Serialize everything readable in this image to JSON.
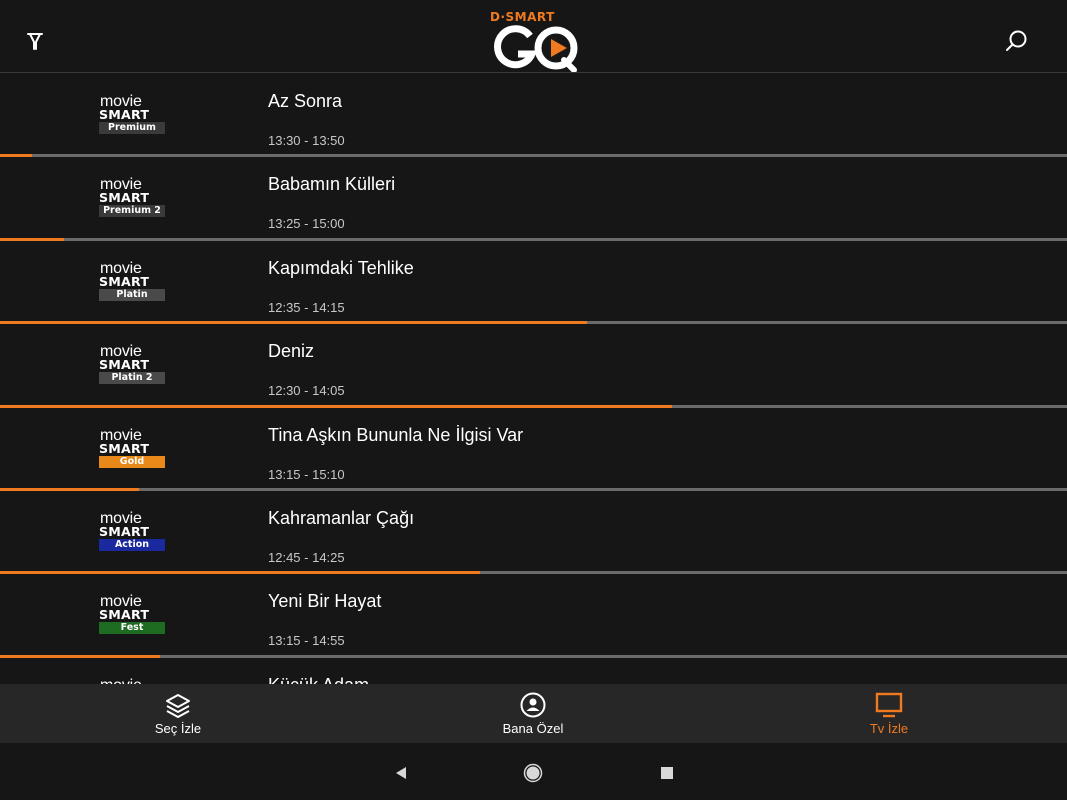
{
  "header": {
    "brand_top": "D·SMART",
    "brand_main": "GO",
    "filter_icon": "filter-icon",
    "search_icon": "search-icon",
    "accent_color": "#f07a1f"
  },
  "channels": [
    {
      "logo_line1": "movie",
      "logo_line2": "SMART",
      "logo_tag": "Premium",
      "tag_color": "#3a3a3a",
      "title": "Az Sonra",
      "time": "13:30 - 13:50",
      "progress": 0.03
    },
    {
      "logo_line1": "movie",
      "logo_line2": "SMART",
      "logo_tag": "Premium 2",
      "tag_color": "#3a3a3a",
      "title": "Babamın Külleri",
      "time": "13:25 - 15:00",
      "progress": 0.06
    },
    {
      "logo_line1": "movie",
      "logo_line2": "SMART",
      "logo_tag": "Platin",
      "tag_color": "#4a4a4a",
      "title": "Kapımdaki Tehlike",
      "time": "12:35 - 14:15",
      "progress": 0.55
    },
    {
      "logo_line1": "movie",
      "logo_line2": "SMART",
      "logo_tag": "Platin 2",
      "tag_color": "#4a4a4a",
      "title": "Deniz",
      "time": "12:30 - 14:05",
      "progress": 0.63
    },
    {
      "logo_line1": "movie",
      "logo_line2": "SMART",
      "logo_tag": "Gold",
      "tag_color": "#e8891a",
      "title": "Tina Aşkın Bununla Ne İlgisi Var",
      "time": "13:15 - 15:10",
      "progress": 0.13
    },
    {
      "logo_line1": "movie",
      "logo_line2": "SMART",
      "logo_tag": "Action",
      "tag_color": "#1a2a9e",
      "title": "Kahramanlar Çağı",
      "time": "12:45 - 14:25",
      "progress": 0.45
    },
    {
      "logo_line1": "movie",
      "logo_line2": "SMART",
      "logo_tag": "Fest",
      "tag_color": "#1e6b22",
      "title": "Yeni Bir Hayat",
      "time": "13:15 - 14:55",
      "progress": 0.15
    },
    {
      "logo_line1": "movie",
      "logo_line2": "",
      "logo_tag": "",
      "tag_color": "#161616",
      "title": "Küçük Adam",
      "time": "",
      "progress": 0
    }
  ],
  "bottom_nav": [
    {
      "label": "Seç İzle",
      "icon": "layers-icon",
      "active": false
    },
    {
      "label": "Bana Özel",
      "icon": "user-circle-icon",
      "active": false
    },
    {
      "label": "Tv İzle",
      "icon": "tv-icon",
      "active": true
    }
  ],
  "system_nav": {
    "back_icon": "back-triangle-icon",
    "home_icon": "home-circle-icon",
    "recents_icon": "recents-square-icon"
  }
}
